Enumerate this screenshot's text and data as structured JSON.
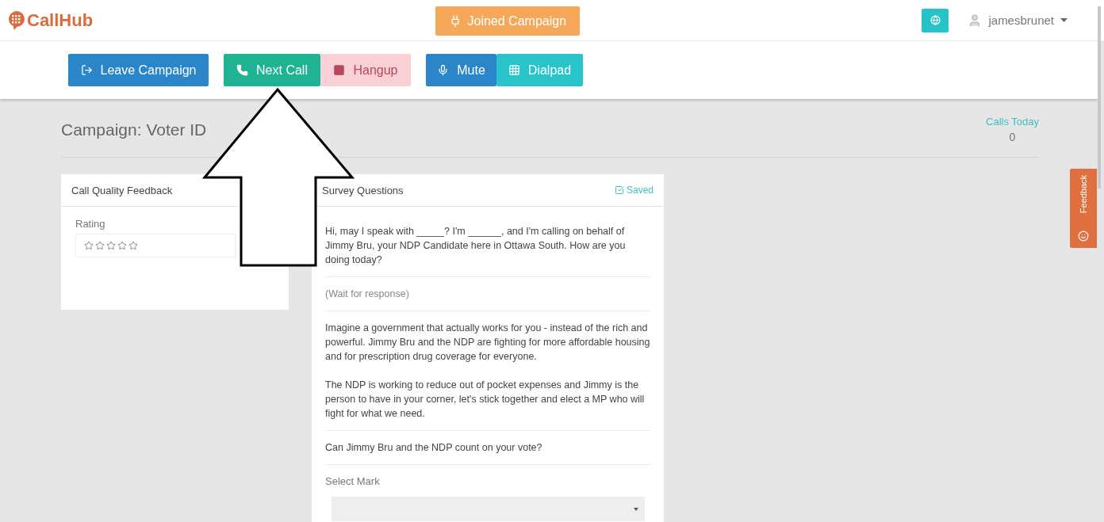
{
  "header": {
    "logo": "CallHub",
    "status_button": "Joined Campaign",
    "user": "jamesbrunet"
  },
  "toolbar": [
    {
      "label": "Leave Campaign",
      "kind": "leave",
      "disabled": false
    },
    {
      "label": "Next Call",
      "kind": "next",
      "disabled": false
    },
    {
      "label": "Hangup",
      "kind": "hangup",
      "disabled": true
    },
    {
      "label": "Mute",
      "kind": "mute",
      "disabled": false
    },
    {
      "label": "Dialpad",
      "kind": "dialpad",
      "disabled": false
    }
  ],
  "campaign": {
    "title": "Campaign: Voter ID",
    "stat_label": "Calls Today",
    "stat_value": "0"
  },
  "feedback_card": {
    "title": "Call Quality Feedback",
    "rating_label": "Rating",
    "stars": 0
  },
  "survey": {
    "title": "Survey Questions",
    "saved": "Saved",
    "items": [
      {
        "kind": "script",
        "paragraphs": [
          "Hi, may I speak with _____? I'm ______, and I'm calling on behalf of Jimmy Bru, your NDP Candidate here in Ottawa South. How are you doing today?"
        ]
      },
      {
        "kind": "note",
        "paragraphs": [
          "(Wait for response)"
        ]
      },
      {
        "kind": "script",
        "paragraphs": [
          "Imagine a government that actually works for you - instead of the rich and powerful. Jimmy Bru and the NDP are fighting for more affordable housing and for prescription drug coverage for everyone.",
          "The NDP is working to reduce out of pocket expenses and Jimmy is the person to have in your corner, let's stick together and elect a MP who will fight for what we need."
        ]
      },
      {
        "kind": "script",
        "paragraphs": [
          "Can Jimmy Bru and the NDP count on your vote?"
        ]
      },
      {
        "kind": "select",
        "paragraphs": [
          "Select Mark"
        ]
      }
    ]
  },
  "feedback_tab": "Feedback"
}
